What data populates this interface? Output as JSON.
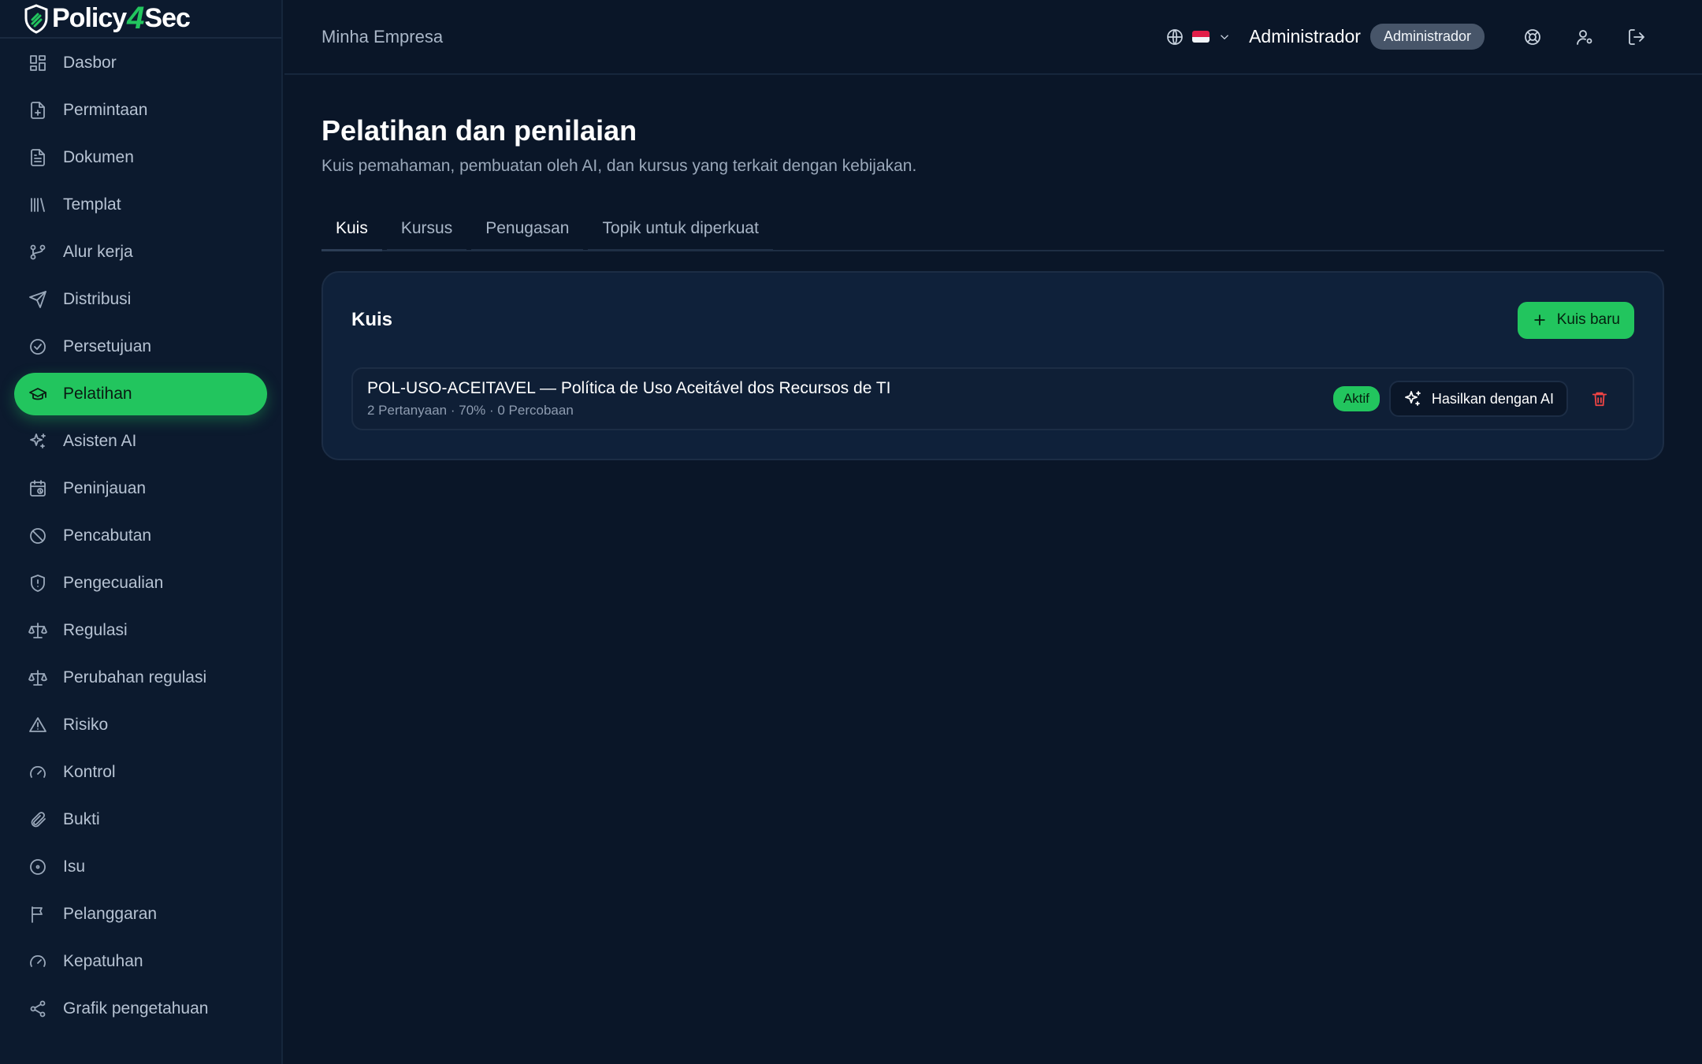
{
  "app": {
    "brand_left": "Policy",
    "brand_four": "4",
    "brand_right": "Sec"
  },
  "sidebar": {
    "items": [
      {
        "label": "Dasbor",
        "icon": "dashboard-icon"
      },
      {
        "label": "Permintaan",
        "icon": "file-plus-icon"
      },
      {
        "label": "Dokumen",
        "icon": "file-text-icon"
      },
      {
        "label": "Templat",
        "icon": "library-icon"
      },
      {
        "label": "Alur kerja",
        "icon": "git-branch-icon"
      },
      {
        "label": "Distribusi",
        "icon": "send-icon"
      },
      {
        "label": "Persetujuan",
        "icon": "check-circle-icon"
      },
      {
        "label": "Pelatihan",
        "icon": "graduation-cap-icon",
        "active": true
      },
      {
        "label": "Asisten AI",
        "icon": "sparkles-icon"
      },
      {
        "label": "Peninjauan",
        "icon": "calendar-clock-icon"
      },
      {
        "label": "Pencabutan",
        "icon": "ban-icon"
      },
      {
        "label": "Pengecualian",
        "icon": "shield-alert-icon"
      },
      {
        "label": "Regulasi",
        "icon": "scale-icon"
      },
      {
        "label": "Perubahan regulasi",
        "icon": "scale-icon"
      },
      {
        "label": "Risiko",
        "icon": "alert-triangle-icon"
      },
      {
        "label": "Kontrol",
        "icon": "gauge-icon"
      },
      {
        "label": "Bukti",
        "icon": "paperclip-icon"
      },
      {
        "label": "Isu",
        "icon": "circle-dot-icon"
      },
      {
        "label": "Pelanggaran",
        "icon": "flag-icon"
      },
      {
        "label": "Kepatuhan",
        "icon": "gauge-icon"
      },
      {
        "label": "Grafik pengetahuan",
        "icon": "share-icon"
      }
    ]
  },
  "header": {
    "company": "Minha Empresa",
    "user": "Administrador",
    "role": "Administrador"
  },
  "page": {
    "title": "Pelatihan dan penilaian",
    "subtitle": "Kuis pemahaman, pembuatan oleh AI, dan kursus yang terkait dengan kebijakan.",
    "tabs": [
      "Kuis",
      "Kursus",
      "Penugasan",
      "Topik untuk diperkuat"
    ]
  },
  "card": {
    "title": "Kuis",
    "new_button": "Kuis baru",
    "quizzes": [
      {
        "name": "POL-USO-ACEITAVEL — Política de Uso Aceitável dos Recursos de TI",
        "meta": "2 Pertanyaan · 70% · 0 Percobaan",
        "status": "Aktif",
        "ai_button": "Hasilkan dengan AI"
      }
    ]
  },
  "colors": {
    "accent": "#22c55e",
    "background": "#0a1628",
    "danger": "#ef4444"
  }
}
